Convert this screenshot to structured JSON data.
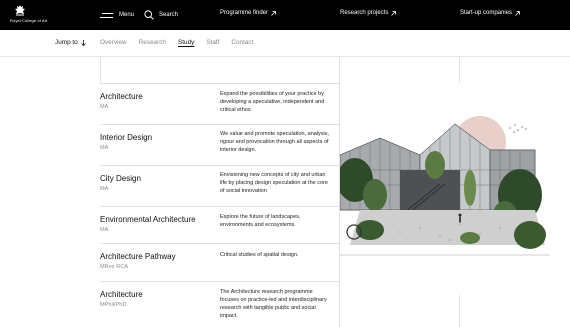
{
  "header": {
    "logo_text": "Royal College of Art",
    "menu_label": "Menu",
    "search_label": "Search",
    "links": [
      {
        "label": "Programme finder"
      },
      {
        "label": "Research projects"
      },
      {
        "label": "Start-up companies"
      }
    ]
  },
  "subnav": {
    "jump_label": "Jump to",
    "tabs": [
      {
        "label": "Overview",
        "active": false
      },
      {
        "label": "Research",
        "active": false
      },
      {
        "label": "Study",
        "active": true
      },
      {
        "label": "Staff",
        "active": false
      },
      {
        "label": "Contact",
        "active": false
      }
    ]
  },
  "programmes": [
    {
      "title": "Architecture",
      "degree": "MA",
      "description": "Expand the possibilities of your practice by developing a speculative, independent and critical ethos"
    },
    {
      "title": "Interior Design",
      "degree": "MA",
      "description": "We value and promote speculation, analysis, rigour and provocation through all aspects of interior design."
    },
    {
      "title": "City Design",
      "degree": "MA",
      "description": "Envisioning new concepts of city and urban life by placing design speculation at the core of social innovation"
    },
    {
      "title": "Environmental Architecture",
      "degree": "MA",
      "description": "Explore the future of landscapes, environments and ecosystems."
    },
    {
      "title": "Architecture Pathway",
      "degree": "MRes RCA",
      "description": "Critical studies of spatial design."
    },
    {
      "title": "Architecture",
      "degree": "MPhil/PhD",
      "description": "The Architecture research programme focuses on practice-led and interdisciplinary research with tangible public and social impact."
    }
  ],
  "colors": {
    "header_bg": "#000000",
    "sun": "#e8cfc9",
    "foliage": "#2f4a2a"
  }
}
